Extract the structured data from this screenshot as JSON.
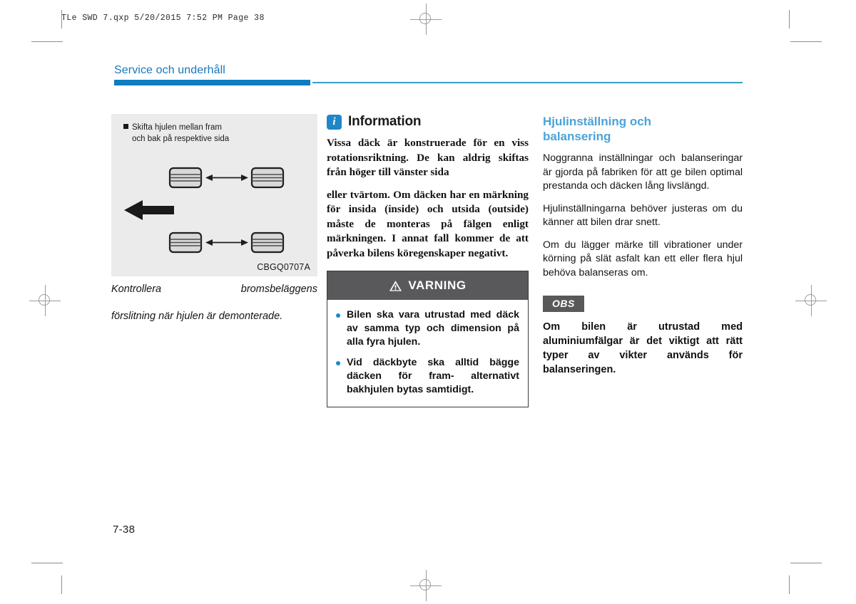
{
  "print_marks": {
    "header_line": "TLe SWD 7.qxp  5/20/2015  7:52 PM  Page 38"
  },
  "page": {
    "section_title": "Service och underhåll",
    "page_number": "7-38",
    "accent_blue": "#0e7cc0",
    "rule_blue": "#3a9ec4"
  },
  "figure": {
    "callout_line1": "Skifta hjulen mellan fram",
    "callout_line2": "och bak på respektive sida",
    "code": "CBGQ0707A",
    "caption_line1": "Kontrollera bromsbeläggens",
    "caption_line2": "förslitning när hjulen är demonterade.",
    "background": "#ebebeb",
    "tire_count": 4,
    "arrow_direction": "left"
  },
  "information": {
    "icon": "info-icon",
    "title": "Information",
    "paragraphs": [
      "Vissa däck är konstruerade för en viss rotationsriktning. De kan aldrig skiftas från höger till vänster sida",
      "eller tvärtom. Om däcken har en märkning för insida (inside) och utsida (outside) måste de monteras på fälgen enligt märkningen. I annat fall kommer de att påverka bilens köregenskaper negativt."
    ]
  },
  "warning": {
    "icon": "warning-triangle-icon",
    "title": "VARNING",
    "header_color": "#59595b",
    "bullet_color": "#1f86c8",
    "items": [
      "Bilen ska vara utrustad med däck av samma typ och dimension på alla fyra hjulen.",
      "Vid däckbyte ska alltid bägge däcken för fram- alternativt bakhjulen bytas samtidigt."
    ]
  },
  "wheel_section": {
    "heading_line1": "Hjulinställning och",
    "heading_line2": "balansering",
    "heading_color": "#4ba3d8",
    "paragraphs": [
      "Noggranna inställningar och balanseringar är gjorda på fabriken för att ge bilen optimal prestanda och däcken lång livslängd.",
      "Hjulinställningarna behöver justeras om du känner att bilen drar snett.",
      "Om du lägger märke till vibrationer under körning på slät asfalt kan ett eller flera hjul behöva balanseras om."
    ],
    "note": {
      "tag": "OBS",
      "tag_color": "#59595b",
      "text": "Om bilen är utrustad med aluminiumfälgar är det viktigt att rätt typer av vikter används för balanseringen."
    }
  }
}
